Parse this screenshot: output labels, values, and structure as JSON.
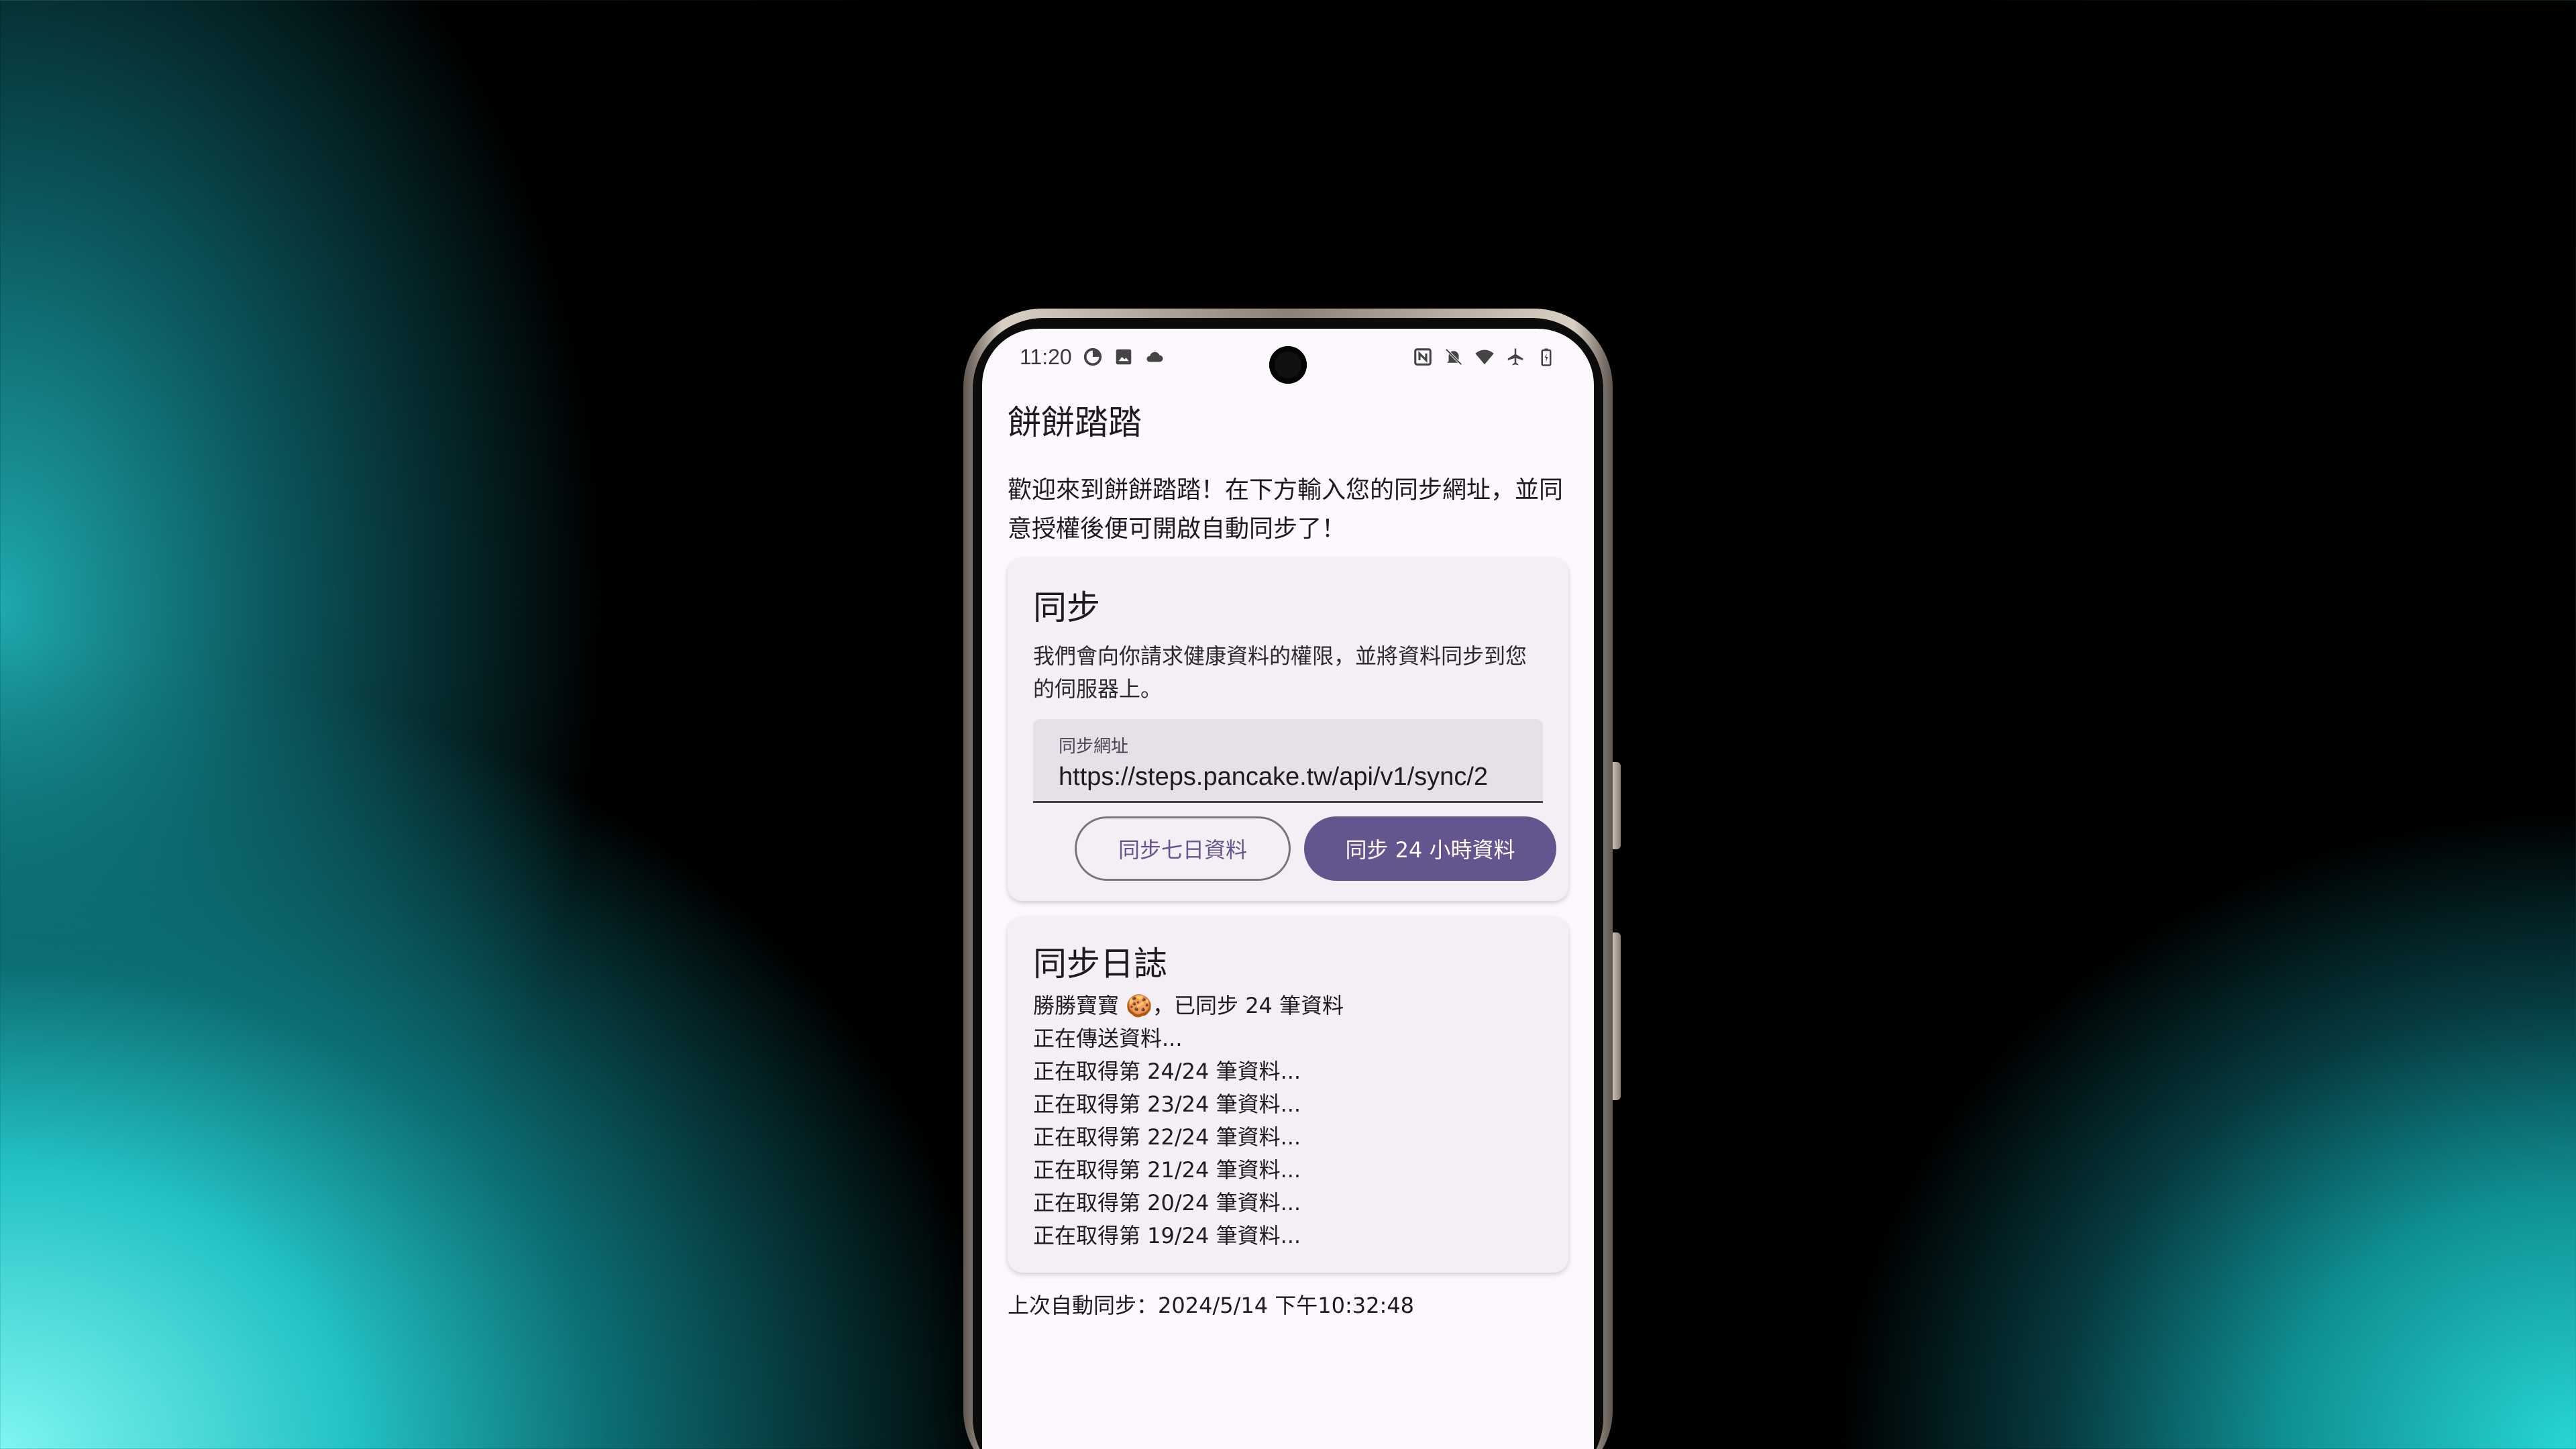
{
  "status_bar": {
    "time": "11:20",
    "left_icons": [
      "data-saver-icon",
      "image-icon",
      "cloud-icon"
    ],
    "right_icons": [
      "nfc-icon",
      "bell-off-icon",
      "wifi-icon",
      "airplane-icon",
      "battery-icon"
    ]
  },
  "app": {
    "title": "餅餅踏踏",
    "intro": "歡迎來到餅餅踏踏！在下方輸入您的同步網址，並同意授權後便可開啟自動同步了！"
  },
  "sync_card": {
    "title": "同步",
    "description": "我們會向你請求健康資料的權限，並將資料同步到您的伺服器上。",
    "url_field": {
      "label": "同步網址",
      "value": "https://steps.pancake.tw/api/v1/sync/2"
    },
    "buttons": {
      "sync_7_days": "同步七日資料",
      "sync_24_hours": "同步 24 小時資料"
    }
  },
  "log_card": {
    "title": "同步日誌",
    "lines": [
      "勝勝寶寶 🍪，已同步 24 筆資料",
      "正在傳送資料...",
      "正在取得第 24/24 筆資料...",
      "正在取得第 23/24 筆資料...",
      "正在取得第 22/24 筆資料...",
      "正在取得第 21/24 筆資料...",
      "正在取得第 20/24 筆資料...",
      "正在取得第 19/24 筆資料..."
    ]
  },
  "last_sync": "上次自動同步：2024/5/14 下午10:32:48",
  "colors": {
    "primary": "#65558f",
    "surface": "#fdf8fd",
    "card": "#f4eff4",
    "field": "#e6e0e9"
  }
}
